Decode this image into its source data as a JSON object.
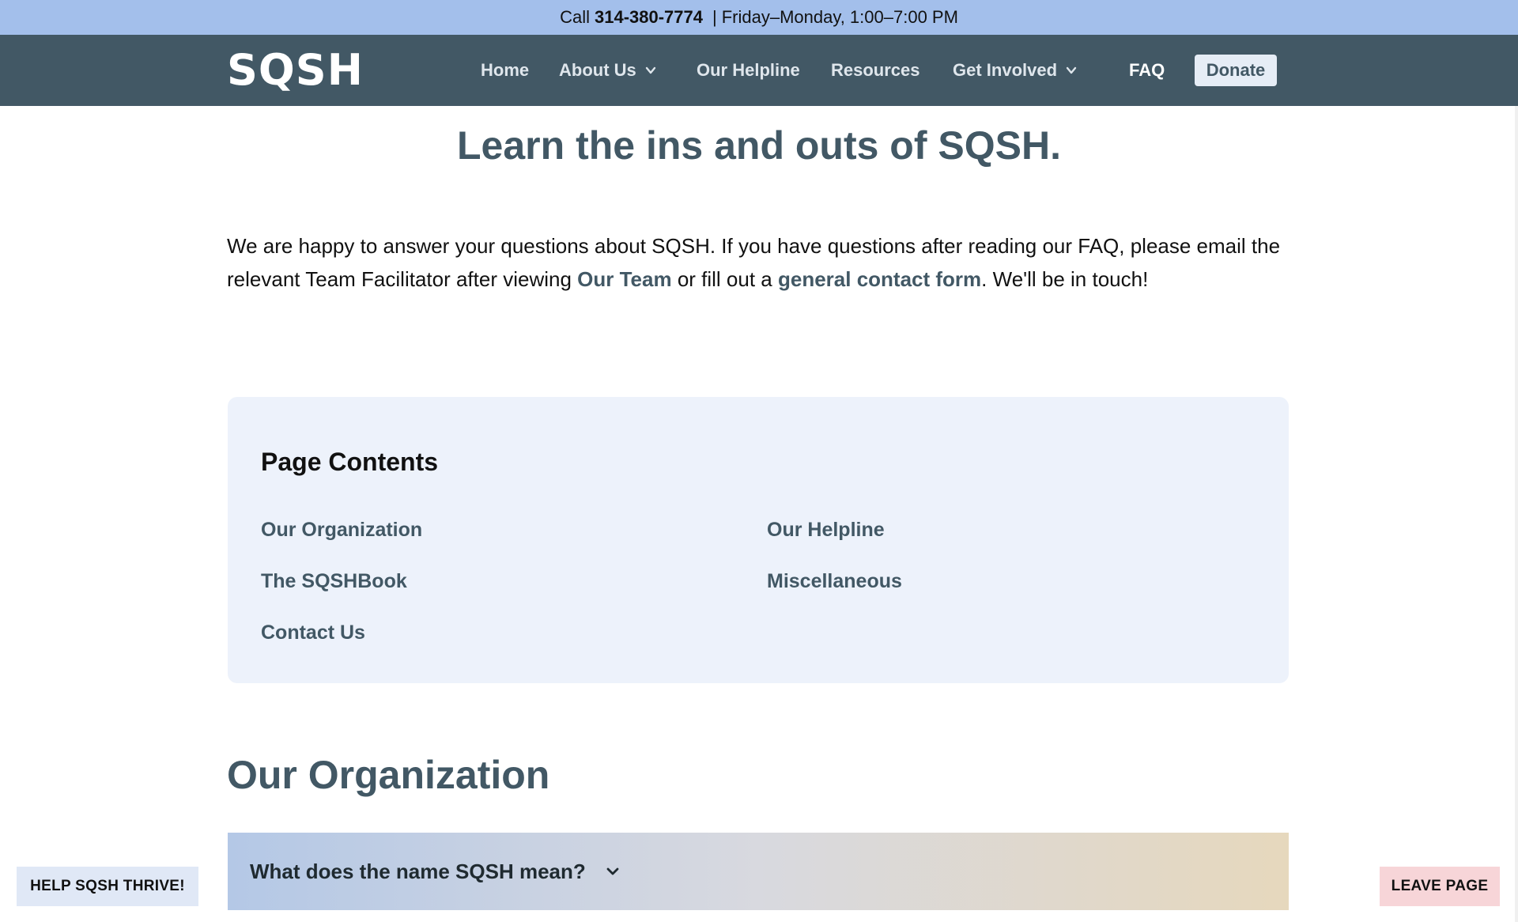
{
  "topbar": {
    "call_prefix": "Call",
    "phone": "314-380-7774",
    "separator": "|",
    "hours": "Friday–Monday, 1:00–7:00 PM"
  },
  "nav": {
    "logo": "SQSH",
    "items": [
      {
        "label": "Home"
      },
      {
        "label": "About Us"
      },
      {
        "label": "Our Helpline"
      },
      {
        "label": "Resources"
      },
      {
        "label": "Get Involved"
      },
      {
        "label": "FAQ"
      }
    ],
    "donate_label": "Donate"
  },
  "hero": {
    "title": "Learn the ins and outs of SQSH."
  },
  "intro": {
    "text_before": "We are happy to answer your questions about SQSH. If you have questions after reading our FAQ, please email the relevant Team Facilitator after viewing ",
    "link_team": "Our Team",
    "text_middle": " or fill out a ",
    "link_contact": "general contact form",
    "text_after": ". We'll be in touch!"
  },
  "contents": {
    "title": "Page Contents",
    "links": [
      {
        "label": "Our Organization"
      },
      {
        "label": "Our Helpline"
      },
      {
        "label": "The SQSHBook"
      },
      {
        "label": "Miscellaneous"
      },
      {
        "label": "Contact Us"
      }
    ]
  },
  "section": {
    "title": "Our Organization",
    "accordion_label": "What does the name SQSH mean?"
  },
  "floating": {
    "help_label": "HELP SQSH THRIVE!",
    "leave_label": "LEAVE PAGE"
  },
  "colors": {
    "topbar_bg": "#a3bfeb",
    "nav_bg": "#425865",
    "accent": "#425865",
    "contents_bg": "#edf2fb",
    "leave_bg": "#f7d5d8",
    "help_bg": "#e0e8f6"
  },
  "icons": {
    "dropdown": "chevron-down-icon"
  }
}
